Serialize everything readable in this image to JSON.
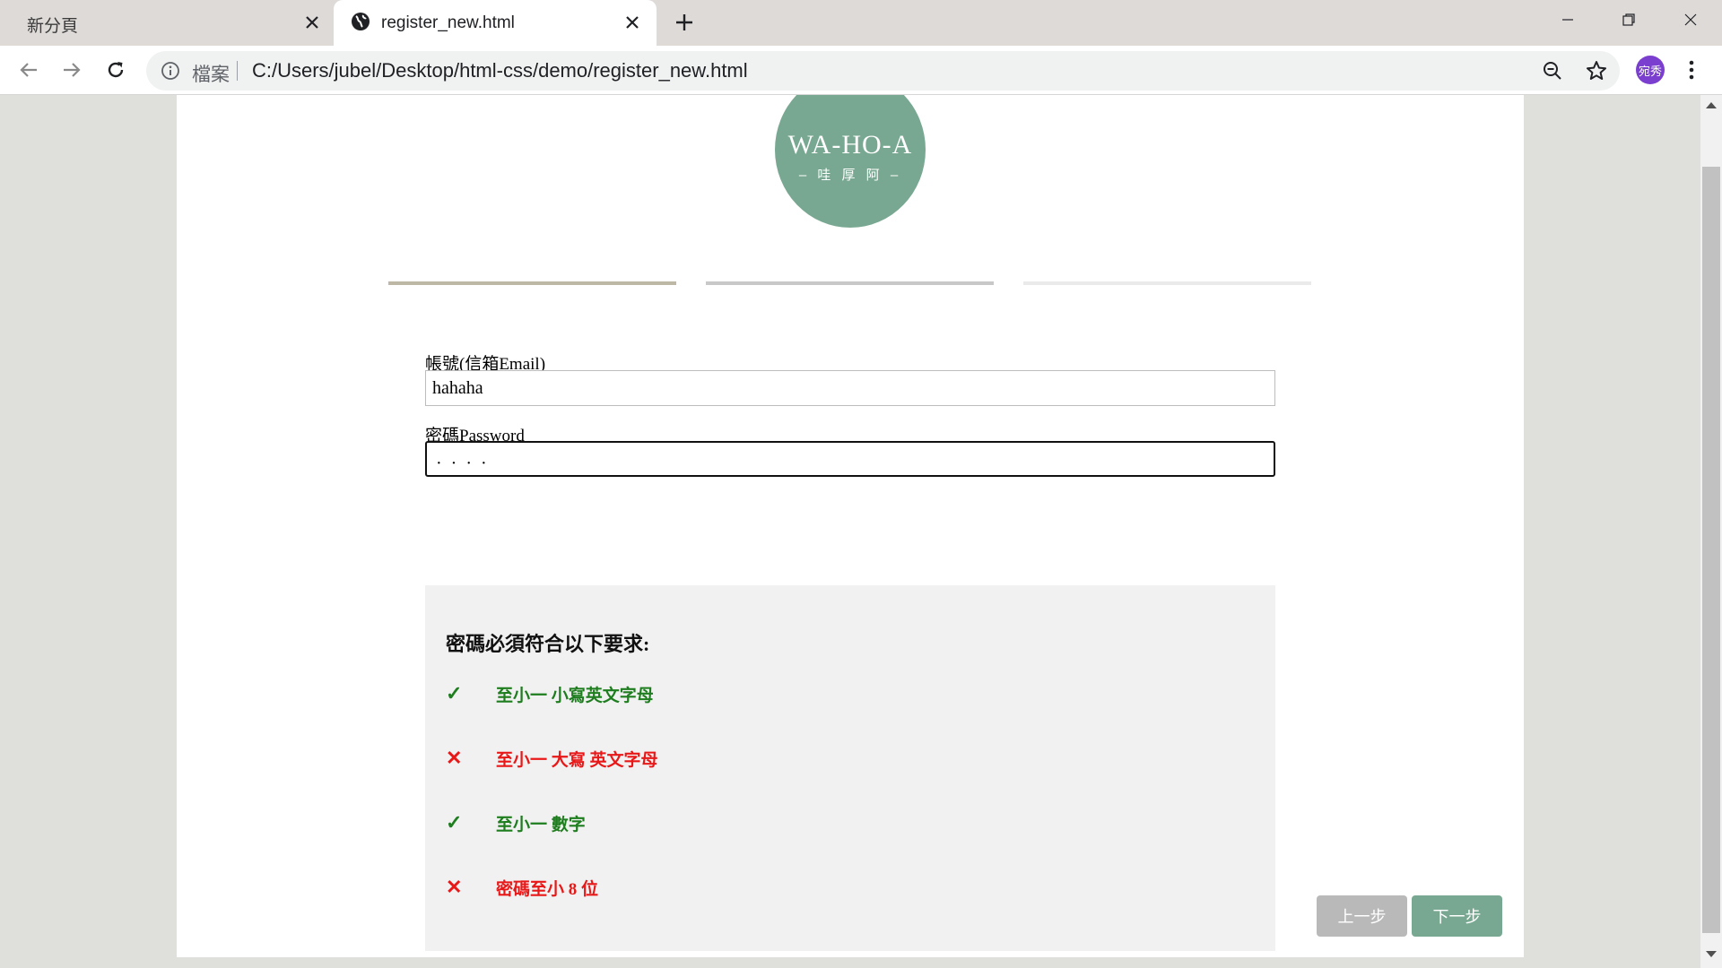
{
  "browser": {
    "tabs": [
      {
        "title": "新分頁",
        "active": false
      },
      {
        "title": "register_new.html",
        "active": true
      }
    ],
    "omnibox": {
      "origin_label": "檔案",
      "url": "C:/Users/jubel/Desktop/html-css/demo/register_new.html"
    },
    "profile": {
      "label": "宛秀",
      "color": "#7a3fce"
    }
  },
  "page": {
    "logo": {
      "main": "WA-HO-A",
      "sub": "– 哇 厚 阿 –",
      "color": "#78a891"
    },
    "steps": {
      "count": 3,
      "current": 1
    },
    "form": {
      "account_label": "帳號(信箱Email)",
      "account_value": "hahaha",
      "password_label": "密碼Password",
      "password_mask": "····"
    },
    "requirements": {
      "title": "密碼必須符合以下要求:",
      "items": [
        {
          "text": "至小一 小寫英文字母",
          "valid": true,
          "mark": "✓"
        },
        {
          "text": "至小一 大寫 英文字母",
          "valid": false,
          "mark": "✕"
        },
        {
          "text": "至小一 數字",
          "valid": true,
          "mark": "✓"
        },
        {
          "text": "密碼至小 8 位",
          "valid": false,
          "mark": "✕"
        }
      ]
    },
    "buttons": {
      "prev": "上一步",
      "next": "下一步"
    }
  },
  "colors": {
    "valid": "#1e7d1e",
    "invalid": "#e81818",
    "brand": "#78a891"
  }
}
